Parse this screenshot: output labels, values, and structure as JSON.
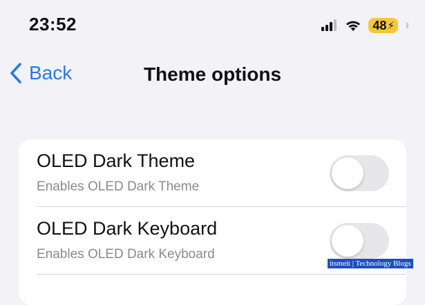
{
  "status_bar": {
    "time": "23:52",
    "battery_level": "48",
    "battery_charging": true,
    "battery_color": "#f6c73a",
    "icons": [
      "signal-icon",
      "wifi-icon",
      "battery-icon"
    ]
  },
  "nav": {
    "back_label": "Back",
    "title": "Theme options",
    "accent_color": "#2a7ae2"
  },
  "settings": [
    {
      "title": "OLED Dark Theme",
      "subtitle": "Enables OLED Dark Theme",
      "enabled": false
    },
    {
      "title": "OLED Dark Keyboard",
      "subtitle": "Enables OLED Dark Keyboard",
      "enabled": false
    }
  ],
  "watermark": {
    "text": "itsmeit | Technology Blogs"
  }
}
